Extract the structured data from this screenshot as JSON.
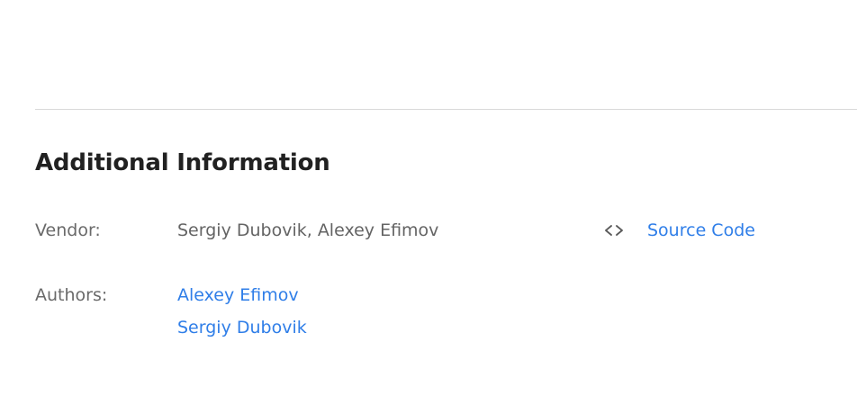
{
  "section": {
    "title": "Additional Information"
  },
  "vendor": {
    "label": "Vendor:",
    "value": "Sergiy Dubovik, Alexey Efimov"
  },
  "authors": {
    "label": "Authors:",
    "items": [
      "Alexey Efimov",
      "Sergiy Dubovik"
    ]
  },
  "source": {
    "icon": "code-brackets-icon",
    "label": "Source Code"
  },
  "colors": {
    "link": "#2f7ee8",
    "label": "#6a6a6a",
    "title": "#212121",
    "divider": "#d9d9d9"
  }
}
